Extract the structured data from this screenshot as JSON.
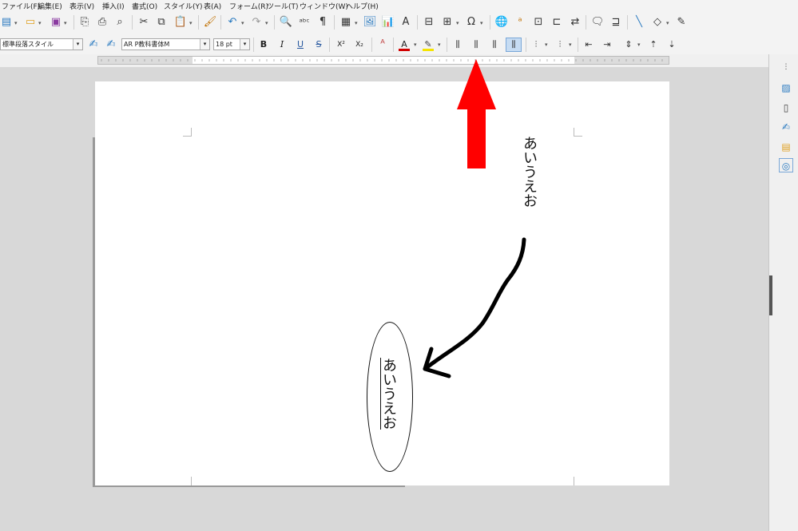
{
  "menu": {
    "file": "ファイル(F)",
    "edit": "編集(E)",
    "view": "表示(V)",
    "insert": "挿入(I)",
    "format": "書式(O)",
    "styles": "スタイル(Y)",
    "table": "表(A)",
    "form": "フォーム(R)",
    "tools": "ツール(T)",
    "window": "ウィンドウ(W)",
    "help": "ヘルプ(H)"
  },
  "format_bar": {
    "paragraph_style": "標準段落スタイル",
    "font_name": "AR P教科書体M",
    "font_size": "18 pt",
    "bold": "B",
    "italic": "I",
    "underline": "U",
    "strike": "S",
    "superscript": "X²",
    "subscript": "X₂"
  },
  "document": {
    "text_top": "あいうえお",
    "text_ellipse": "あいうえお"
  },
  "colors": {
    "font_color": "#d10000",
    "highlight_color": "#f5e400",
    "annotation_arrow": "#ff0000",
    "active_button": "#c6dcf3"
  }
}
